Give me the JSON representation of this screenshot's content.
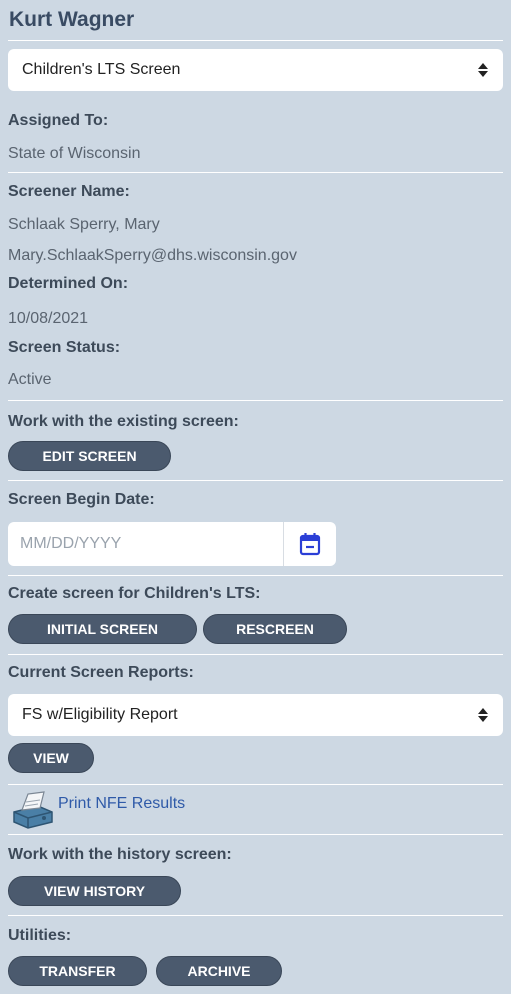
{
  "header": {
    "name": "Kurt Wagner"
  },
  "screen_select": {
    "value": "Children's LTS Screen"
  },
  "assigned_to": {
    "label": "Assigned To:",
    "value": "State of Wisconsin"
  },
  "screener": {
    "label": "Screener Name:",
    "name": "Schlaak Sperry, Mary",
    "email": "Mary.SchlaakSperry@dhs.wisconsin.gov"
  },
  "determined_on": {
    "label": "Determined On:",
    "value": "10/08/2021"
  },
  "screen_status": {
    "label": "Screen Status:",
    "value": "Active"
  },
  "existing_screen": {
    "label": "Work with the existing screen:",
    "edit_button": "EDIT SCREEN"
  },
  "begin_date": {
    "label": "Screen Begin Date:",
    "placeholder": "MM/DD/YYYY",
    "icon": "calendar-icon"
  },
  "create_screen": {
    "label": "Create screen for Children's LTS:",
    "initial_button": "INITIAL SCREEN",
    "rescreen_button": "RESCREEN"
  },
  "reports": {
    "label": "Current Screen Reports:",
    "selected": "FS w/Eligibility Report",
    "view_button": "VIEW"
  },
  "nfe": {
    "link": "Print NFE Results",
    "icon": "printer-icon"
  },
  "history": {
    "label": "Work with the history screen:",
    "view_button": "VIEW HISTORY"
  },
  "utilities": {
    "label": "Utilities:",
    "transfer_button": "TRANSFER",
    "archive_button": "ARCHIVE"
  },
  "colors": {
    "panel_bg": "#cdd8e3",
    "button_bg": "#4b5a6e",
    "link": "#2f5aa8",
    "title": "#394b63"
  }
}
